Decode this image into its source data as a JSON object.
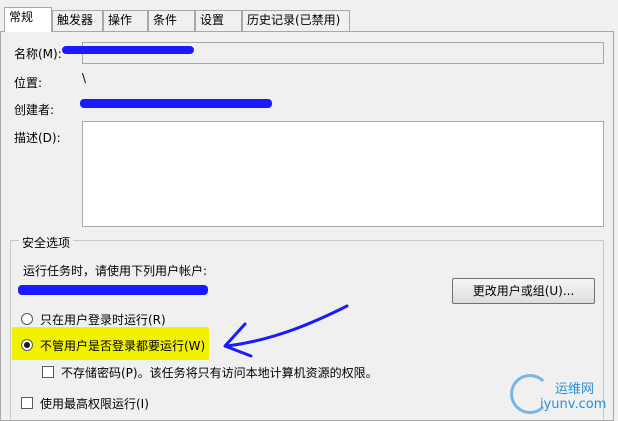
{
  "tabs": [
    {
      "label": "常规",
      "active": true
    },
    {
      "label": "触发器",
      "active": false
    },
    {
      "label": "操作",
      "active": false
    },
    {
      "label": "条件",
      "active": false
    },
    {
      "label": "设置",
      "active": false
    },
    {
      "label": "历史记录(已禁用)",
      "active": false
    }
  ],
  "general": {
    "name_label": "名称(M):",
    "location_label": "位置:",
    "location_value": "\\",
    "author_label": "创建者:",
    "description_label": "描述(D):"
  },
  "security": {
    "group_title": "安全选项",
    "run_as_prompt": "运行任务时，请使用下列用户帐户:",
    "change_user_button": "更改用户或组(U)...",
    "option_logged_on": "只在用户登录时运行(R)",
    "option_whether_logged_on": "不管用户是否登录都要运行(W)",
    "selected_option": "option_whether_logged_on",
    "do_not_store_password": "不存储密码(P)。该任务将只有访问本地计算机资源的权限。",
    "do_not_store_password_checked": false,
    "run_highest_privileges": "使用最高权限运行(I)",
    "run_highest_privileges_checked": false
  },
  "watermark": {
    "cn": "运维网",
    "url": "iyunv.com"
  },
  "colors": {
    "highlight": "#f2f200",
    "annotation_ink": "#1a1aff",
    "watermark": "#2a8fd6"
  }
}
